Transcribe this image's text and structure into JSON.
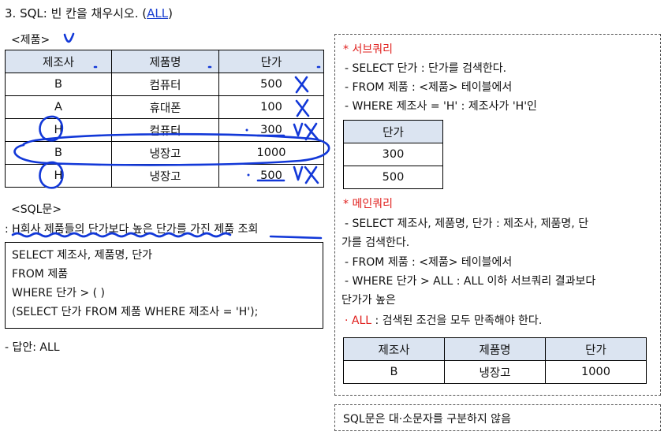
{
  "question": {
    "title": "3. SQL: 빈 칸을 채우시오. (",
    "answer_highlight": "ALL",
    "title_end": ")"
  },
  "product_label": "<제품>",
  "product_table": {
    "headers": [
      "제조사",
      "제품명",
      "단가"
    ],
    "rows": [
      [
        "B",
        "컴퓨터",
        "500"
      ],
      [
        "A",
        "휴대폰",
        "100"
      ],
      [
        "H",
        "컴퓨터",
        "300"
      ],
      [
        "B",
        "냉장고",
        "1000"
      ],
      [
        "H",
        "냉장고",
        "500"
      ]
    ]
  },
  "sql_label": "<SQL문>",
  "sql_description": ": H회사 제품들의 단가보다 높은 단가를 가진 제품 조회",
  "sql_lines": [
    "SELECT 제조사, 제품명, 단가",
    "FROM 제품",
    "WHERE 단가 > (      )",
    "(SELECT 단가 FROM 제품 WHERE 제조사 = 'H');"
  ],
  "answer": "- 답안: ALL",
  "panel": {
    "subquery_title": "* 서브쿼리",
    "subquery_lines": [
      "- SELECT 단가 : 단가를 검색한다.",
      "- FROM 제품 : <제품> 테이블에서",
      "- WHERE 제조사 = 'H' : 제조사가 'H'인"
    ],
    "subquery_table": {
      "header": "단가",
      "rows": [
        "300",
        "500"
      ]
    },
    "mainquery_title": "* 메인쿼리",
    "mainquery_lines": [
      "- SELECT 제조사, 제품명, 단가 : 제조사, 제품명, 단",
      "가를 검색한다.",
      "- FROM 제품 : <제품> 테이블에서",
      "- WHERE 단가 > ALL : ALL 이하 서브쿼리 결과보다",
      "단가가 높은"
    ],
    "all_note_prefix": "· ALL",
    "all_note_rest": " : 검색된 조건을 모두 만족해야 한다.",
    "result_table": {
      "headers": [
        "제조사",
        "제품명",
        "단가"
      ],
      "rows": [
        [
          "B",
          "냉장고",
          "1000"
        ]
      ]
    }
  },
  "note": "SQL문은 대·소문자를 구분하지 않음",
  "colors": {
    "accent_red": "#e0201e",
    "annotation_blue": "#1238d8",
    "header_bg": "#dbe4f1"
  }
}
